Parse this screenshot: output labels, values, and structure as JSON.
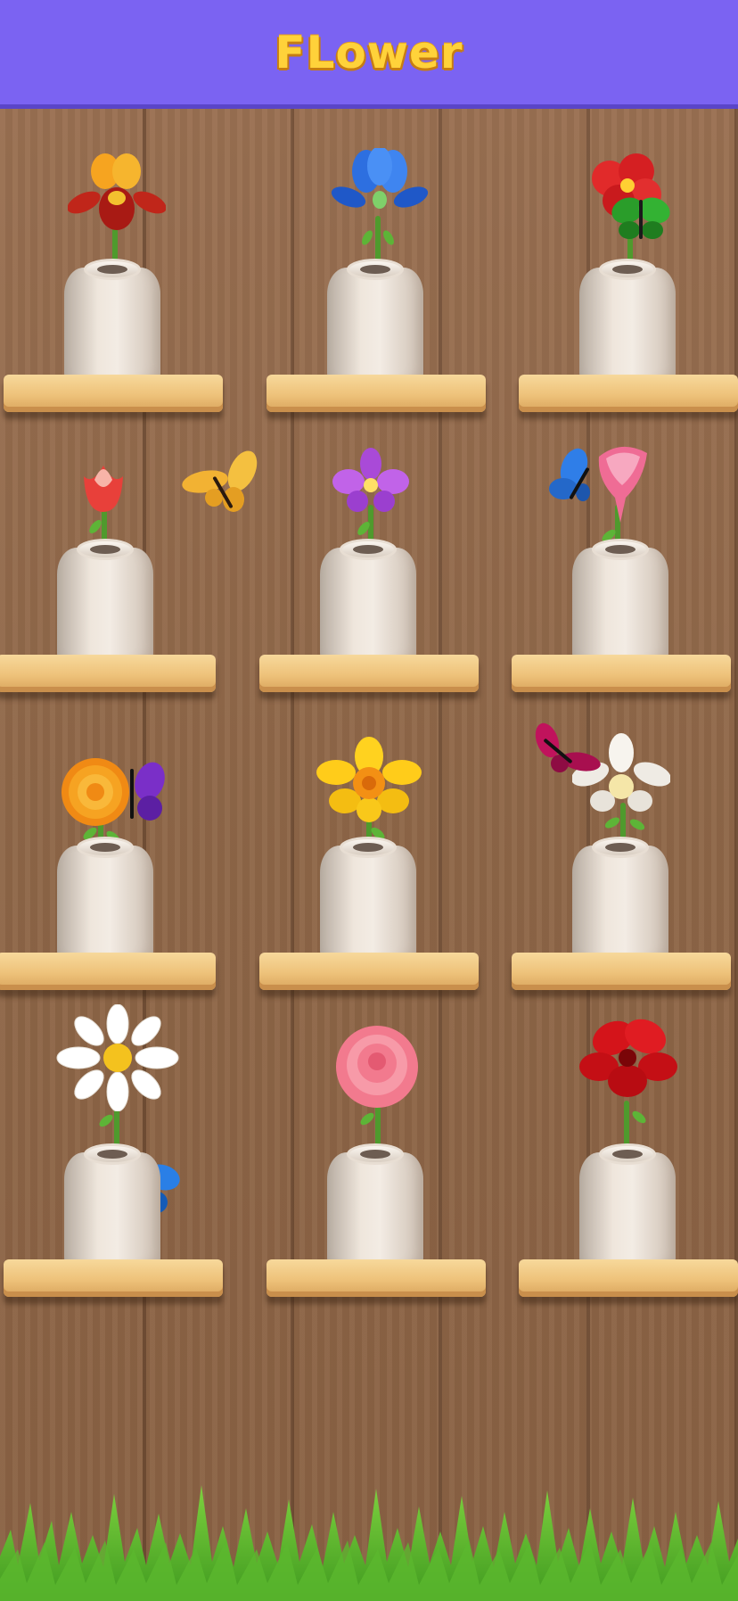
{
  "header": {
    "title": "FLower"
  },
  "shelves": [
    {
      "flower": "iris-orange"
    },
    {
      "flower": "iris-blue"
    },
    {
      "flower": "hibiscus-red"
    },
    {
      "flower": "tulip-red"
    },
    {
      "flower": "orchid-purple"
    },
    {
      "flower": "calla-lily-pink"
    },
    {
      "flower": "marigold-orange"
    },
    {
      "flower": "daffodil-yellow"
    },
    {
      "flower": "orchid-white"
    },
    {
      "flower": "daisy-white"
    },
    {
      "flower": "rose-pink"
    },
    {
      "flower": "amaryllis-red"
    }
  ],
  "butterflies": [
    "butterfly-green",
    "butterfly-yellow",
    "butterfly-blue",
    "butterfly-purple",
    "butterfly-magenta",
    "butterfly-blue"
  ],
  "colors": {
    "header_bg": "#7b63f2",
    "title": "#ffd23a",
    "wood": "#8f6748",
    "shelf": "#eec27a",
    "vase": "#efe6dc"
  }
}
